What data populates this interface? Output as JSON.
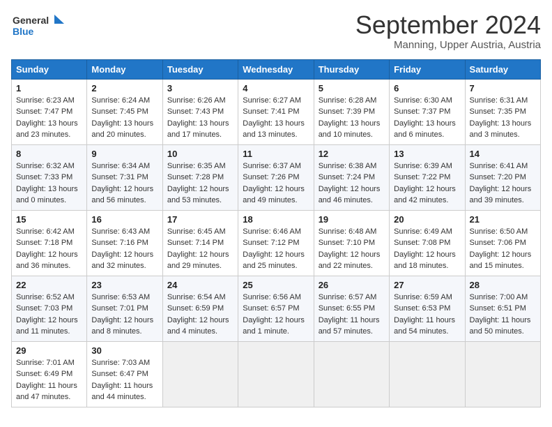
{
  "header": {
    "logo_general": "General",
    "logo_blue": "Blue",
    "month": "September 2024",
    "location": "Manning, Upper Austria, Austria"
  },
  "days_of_week": [
    "Sunday",
    "Monday",
    "Tuesday",
    "Wednesday",
    "Thursday",
    "Friday",
    "Saturday"
  ],
  "weeks": [
    [
      {
        "day": "1",
        "info": "Sunrise: 6:23 AM\nSunset: 7:47 PM\nDaylight: 13 hours\nand 23 minutes."
      },
      {
        "day": "2",
        "info": "Sunrise: 6:24 AM\nSunset: 7:45 PM\nDaylight: 13 hours\nand 20 minutes."
      },
      {
        "day": "3",
        "info": "Sunrise: 6:26 AM\nSunset: 7:43 PM\nDaylight: 13 hours\nand 17 minutes."
      },
      {
        "day": "4",
        "info": "Sunrise: 6:27 AM\nSunset: 7:41 PM\nDaylight: 13 hours\nand 13 minutes."
      },
      {
        "day": "5",
        "info": "Sunrise: 6:28 AM\nSunset: 7:39 PM\nDaylight: 13 hours\nand 10 minutes."
      },
      {
        "day": "6",
        "info": "Sunrise: 6:30 AM\nSunset: 7:37 PM\nDaylight: 13 hours\nand 6 minutes."
      },
      {
        "day": "7",
        "info": "Sunrise: 6:31 AM\nSunset: 7:35 PM\nDaylight: 13 hours\nand 3 minutes."
      }
    ],
    [
      {
        "day": "8",
        "info": "Sunrise: 6:32 AM\nSunset: 7:33 PM\nDaylight: 13 hours\nand 0 minutes."
      },
      {
        "day": "9",
        "info": "Sunrise: 6:34 AM\nSunset: 7:31 PM\nDaylight: 12 hours\nand 56 minutes."
      },
      {
        "day": "10",
        "info": "Sunrise: 6:35 AM\nSunset: 7:28 PM\nDaylight: 12 hours\nand 53 minutes."
      },
      {
        "day": "11",
        "info": "Sunrise: 6:37 AM\nSunset: 7:26 PM\nDaylight: 12 hours\nand 49 minutes."
      },
      {
        "day": "12",
        "info": "Sunrise: 6:38 AM\nSunset: 7:24 PM\nDaylight: 12 hours\nand 46 minutes."
      },
      {
        "day": "13",
        "info": "Sunrise: 6:39 AM\nSunset: 7:22 PM\nDaylight: 12 hours\nand 42 minutes."
      },
      {
        "day": "14",
        "info": "Sunrise: 6:41 AM\nSunset: 7:20 PM\nDaylight: 12 hours\nand 39 minutes."
      }
    ],
    [
      {
        "day": "15",
        "info": "Sunrise: 6:42 AM\nSunset: 7:18 PM\nDaylight: 12 hours\nand 36 minutes."
      },
      {
        "day": "16",
        "info": "Sunrise: 6:43 AM\nSunset: 7:16 PM\nDaylight: 12 hours\nand 32 minutes."
      },
      {
        "day": "17",
        "info": "Sunrise: 6:45 AM\nSunset: 7:14 PM\nDaylight: 12 hours\nand 29 minutes."
      },
      {
        "day": "18",
        "info": "Sunrise: 6:46 AM\nSunset: 7:12 PM\nDaylight: 12 hours\nand 25 minutes."
      },
      {
        "day": "19",
        "info": "Sunrise: 6:48 AM\nSunset: 7:10 PM\nDaylight: 12 hours\nand 22 minutes."
      },
      {
        "day": "20",
        "info": "Sunrise: 6:49 AM\nSunset: 7:08 PM\nDaylight: 12 hours\nand 18 minutes."
      },
      {
        "day": "21",
        "info": "Sunrise: 6:50 AM\nSunset: 7:06 PM\nDaylight: 12 hours\nand 15 minutes."
      }
    ],
    [
      {
        "day": "22",
        "info": "Sunrise: 6:52 AM\nSunset: 7:03 PM\nDaylight: 12 hours\nand 11 minutes."
      },
      {
        "day": "23",
        "info": "Sunrise: 6:53 AM\nSunset: 7:01 PM\nDaylight: 12 hours\nand 8 minutes."
      },
      {
        "day": "24",
        "info": "Sunrise: 6:54 AM\nSunset: 6:59 PM\nDaylight: 12 hours\nand 4 minutes."
      },
      {
        "day": "25",
        "info": "Sunrise: 6:56 AM\nSunset: 6:57 PM\nDaylight: 12 hours\nand 1 minute."
      },
      {
        "day": "26",
        "info": "Sunrise: 6:57 AM\nSunset: 6:55 PM\nDaylight: 11 hours\nand 57 minutes."
      },
      {
        "day": "27",
        "info": "Sunrise: 6:59 AM\nSunset: 6:53 PM\nDaylight: 11 hours\nand 54 minutes."
      },
      {
        "day": "28",
        "info": "Sunrise: 7:00 AM\nSunset: 6:51 PM\nDaylight: 11 hours\nand 50 minutes."
      }
    ],
    [
      {
        "day": "29",
        "info": "Sunrise: 7:01 AM\nSunset: 6:49 PM\nDaylight: 11 hours\nand 47 minutes."
      },
      {
        "day": "30",
        "info": "Sunrise: 7:03 AM\nSunset: 6:47 PM\nDaylight: 11 hours\nand 44 minutes."
      },
      {
        "day": "",
        "info": ""
      },
      {
        "day": "",
        "info": ""
      },
      {
        "day": "",
        "info": ""
      },
      {
        "day": "",
        "info": ""
      },
      {
        "day": "",
        "info": ""
      }
    ]
  ]
}
